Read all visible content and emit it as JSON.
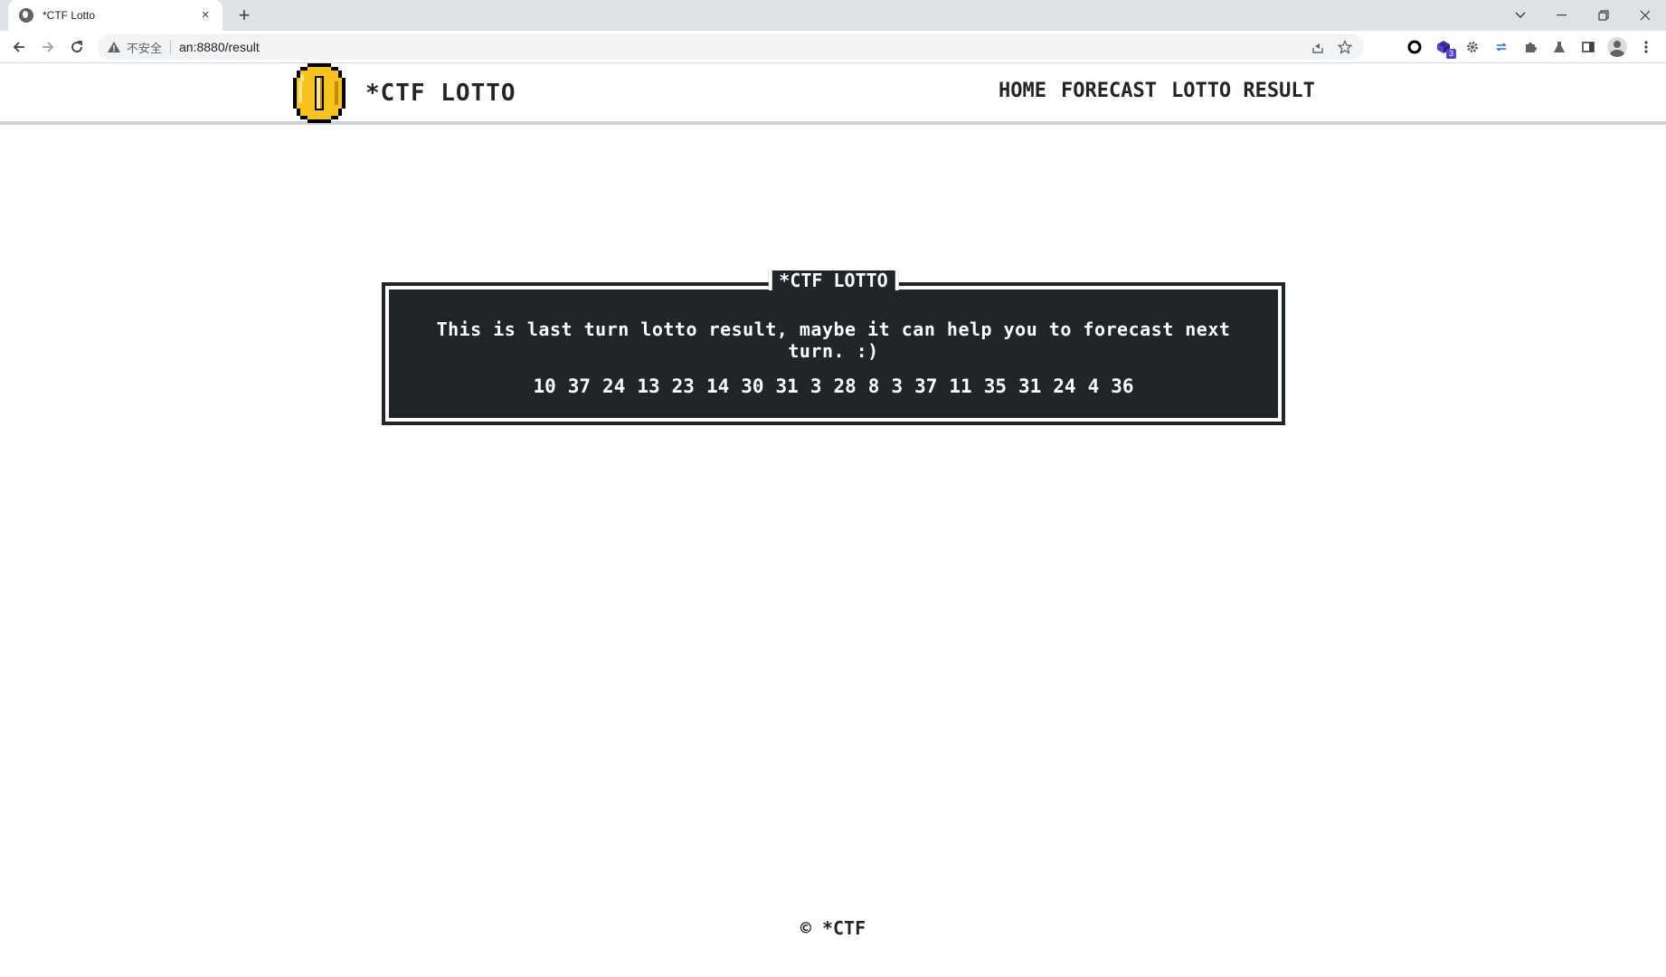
{
  "browser": {
    "tab_title": "*CTF Lotto",
    "tab_close": "×",
    "new_tab": "+",
    "security_label": "不安全",
    "url": "an:8880/result",
    "extension_badge": "3"
  },
  "site": {
    "brand": "*CTF LOTTO",
    "nav": [
      {
        "label": "HOME"
      },
      {
        "label": "FORECAST"
      },
      {
        "label": "LOTTO RESULT"
      }
    ]
  },
  "result_box": {
    "title": "*CTF LOTTO",
    "message": "This is last turn lotto result, maybe it can help you to forecast next turn. :)",
    "numbers": [
      "10",
      "37",
      "24",
      "13",
      "23",
      "14",
      "30",
      "31",
      "3",
      "28",
      "8",
      "3",
      "37",
      "11",
      "35",
      "31",
      "24",
      "4",
      "36"
    ]
  },
  "footer": {
    "text": "© *CTF"
  },
  "colors": {
    "dark": "#212529",
    "coin": "#f7c21b"
  }
}
